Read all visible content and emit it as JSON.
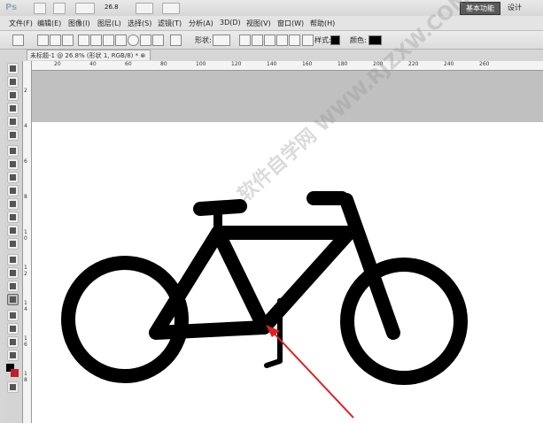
{
  "app": {
    "logo": "Ps",
    "zoom": "26.8",
    "workspace": {
      "active": "基本功能",
      "other": "设计"
    }
  },
  "menu": [
    "文件(F)",
    "编辑(E)",
    "图像(I)",
    "图层(L)",
    "选择(S)",
    "滤镜(T)",
    "分析(A)",
    "3D(D)",
    "视图(V)",
    "窗口(W)",
    "帮助(H)"
  ],
  "options": {
    "shape_label": "形状:",
    "style_label": "样式:",
    "color_label": "颜色:",
    "color": "#000000"
  },
  "document": {
    "tab": "未标题-1 @ 26.8% (形状 1, RGB/8) * ⊗"
  },
  "ruler": {
    "h": [
      "20",
      "40",
      "60",
      "80",
      "100",
      "120",
      "140",
      "160",
      "180",
      "200",
      "220",
      "240",
      "260"
    ],
    "v": [
      "2",
      "4",
      "6",
      "8",
      "1 0",
      "1 2",
      "1 4",
      "1 6",
      "1 8"
    ]
  },
  "colors": {
    "foreground": "#000000",
    "background": "#c0202a",
    "shape": "#000000",
    "arrow": "#e02020"
  },
  "watermark": "软件自学网 WWW.RJZXW.COM"
}
